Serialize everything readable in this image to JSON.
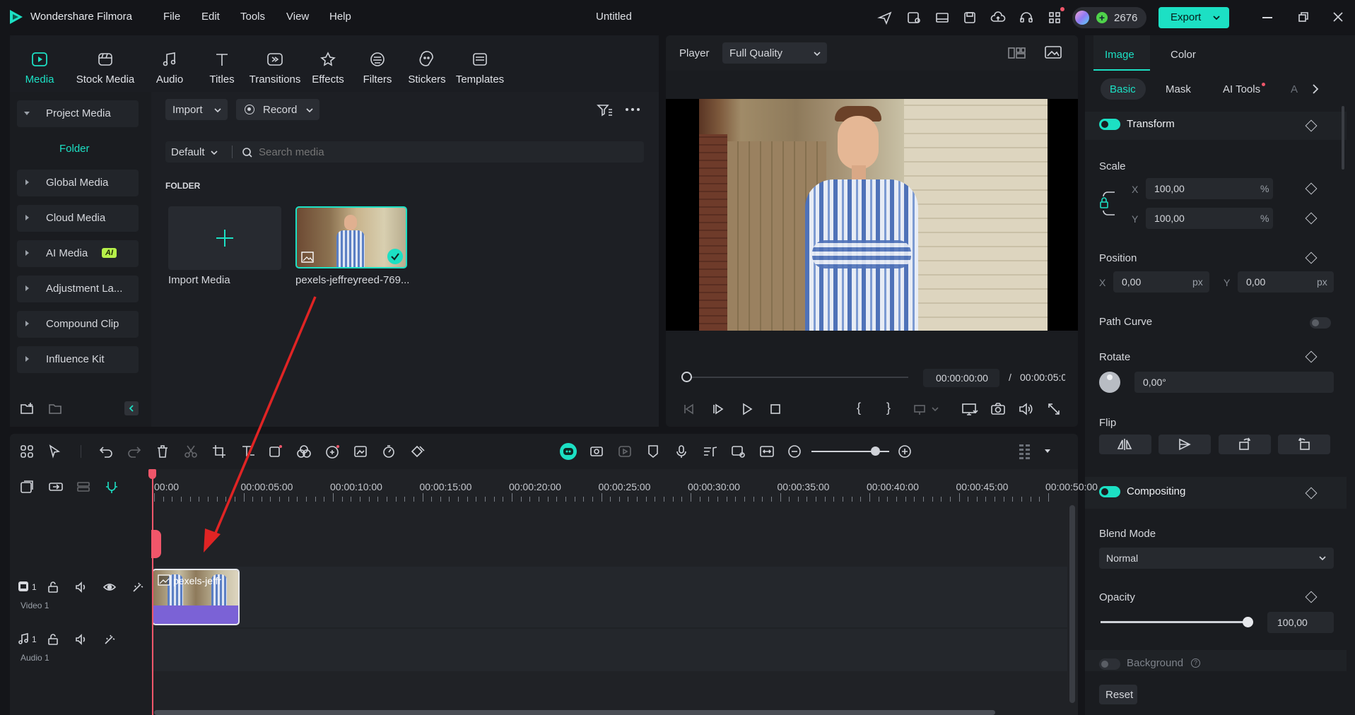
{
  "app": {
    "name": "Wondershare Filmora",
    "window_title": "Untitled",
    "menu": [
      "File",
      "Edit",
      "Tools",
      "View",
      "Help"
    ],
    "credits": "2676",
    "export_label": "Export"
  },
  "toolbar_tabs": [
    {
      "label": "Media",
      "icon": "media-icon",
      "active": true
    },
    {
      "label": "Stock Media",
      "icon": "stock-media-icon"
    },
    {
      "label": "Audio",
      "icon": "audio-icon"
    },
    {
      "label": "Titles",
      "icon": "titles-icon"
    },
    {
      "label": "Transitions",
      "icon": "transitions-icon"
    },
    {
      "label": "Effects",
      "icon": "effects-icon"
    },
    {
      "label": "Filters",
      "icon": "filters-icon"
    },
    {
      "label": "Stickers",
      "icon": "stickers-icon"
    },
    {
      "label": "Templates",
      "icon": "templates-icon"
    }
  ],
  "sidebar": {
    "project_media": "Project Media",
    "folder": "Folder",
    "items": [
      "Global Media",
      "Cloud Media",
      "AI Media",
      "Adjustment La...",
      "Compound Clip",
      "Influence Kit"
    ],
    "ai_badge": "AI"
  },
  "media": {
    "import_label": "Import",
    "record_label": "Record",
    "sort_label": "Default",
    "search_placeholder": "Search media",
    "section_title": "FOLDER",
    "import_tile_label": "Import Media",
    "clip_label": "pexels-jeffreyreed-769..."
  },
  "player": {
    "label": "Player",
    "quality": "Full Quality",
    "current_time": "00:00:00:00",
    "separator": "/",
    "total_time": "00:00:05:0"
  },
  "properties": {
    "tabs": [
      "Image",
      "Color"
    ],
    "subtabs": [
      "Basic",
      "Mask",
      "AI Tools",
      "A"
    ],
    "transform": "Transform",
    "scale": "Scale",
    "scale_x": "100,00",
    "scale_y": "100,00",
    "percent": "%",
    "x_label": "X",
    "y_label": "Y",
    "position": "Position",
    "pos_x": "0,00",
    "pos_y": "0,00",
    "px": "px",
    "path_curve": "Path Curve",
    "rotate": "Rotate",
    "rotate_value": "0,00°",
    "flip": "Flip",
    "compositing": "Compositing",
    "blend_mode": "Blend Mode",
    "blend_value": "Normal",
    "opacity": "Opacity",
    "opacity_value": "100,00",
    "opacity_level": 1.0,
    "background": "Background",
    "reset": "Reset"
  },
  "timeline": {
    "ruler": [
      "00:00",
      "00:00:05:00",
      "00:00:10:00",
      "00:00:15:00",
      "00:00:20:00",
      "00:00:25:00",
      "00:00:30:00",
      "00:00:35:00",
      "00:00:40:00",
      "00:00:45:00",
      "00:00:50:00"
    ],
    "video_track_number": "1",
    "video_track_name": "Video 1",
    "audio_track_number": "1",
    "audio_track_name": "Audio 1",
    "clip_label": "pexels-jeffr"
  },
  "colors": {
    "accent": "#1ce0c4",
    "playhead": "#f0566a",
    "arrow": "#e02424",
    "clip_purple": "#7b62d6"
  }
}
